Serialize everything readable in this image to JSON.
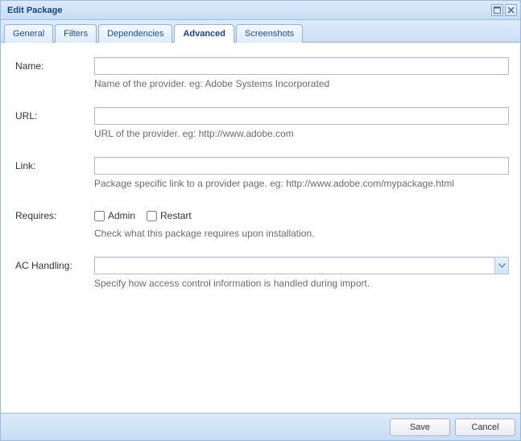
{
  "window": {
    "title": "Edit Package"
  },
  "tabs": [
    {
      "label": "General"
    },
    {
      "label": "Filters"
    },
    {
      "label": "Dependencies"
    },
    {
      "label": "Advanced"
    },
    {
      "label": "Screenshots"
    }
  ],
  "form": {
    "name": {
      "label": "Name:",
      "value": "",
      "help": "Name of the provider. eg: Adobe Systems Incorporated"
    },
    "url": {
      "label": "URL:",
      "value": "",
      "help": "URL of the provider. eg: http://www.adobe.com"
    },
    "link": {
      "label": "Link:",
      "value": "",
      "help": "Package specific link to a provider page. eg: http://www.adobe.com/mypackage.html"
    },
    "requires": {
      "label": "Requires:",
      "admin_label": "Admin",
      "restart_label": "Restart",
      "help": "Check what this package requires upon installation."
    },
    "ac": {
      "label": "AC Handling:",
      "value": "",
      "help": "Specify how access control information is handled during import."
    }
  },
  "footer": {
    "save": "Save",
    "cancel": "Cancel"
  }
}
